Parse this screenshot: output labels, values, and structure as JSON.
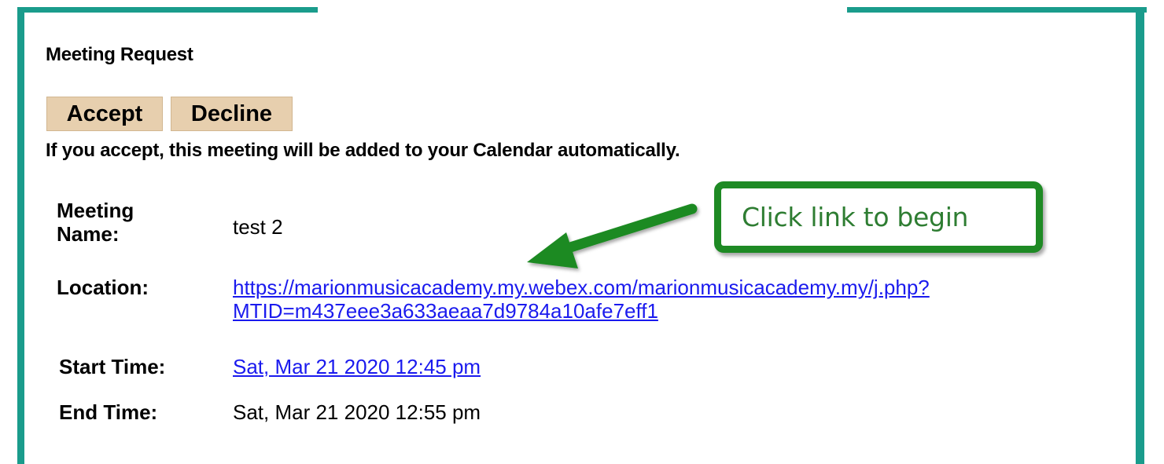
{
  "heading": "Meeting Request",
  "buttons": {
    "accept": "Accept",
    "decline": "Decline"
  },
  "note": "If you accept, this meeting will be added to your Calendar automatically.",
  "details": {
    "meeting_name_label_line1": "Meeting",
    "meeting_name_label_line2": "Name:",
    "meeting_name_value": "test 2",
    "location_label": "Location:",
    "location_line1": "https://marionmusicacademy.my.webex.com/marionmusicacademy.my/j.php?",
    "location_line2": "MTID=m437eee3a633aeaa7d9784a10afe7eff1",
    "start_time_label": "Start Time:",
    "start_time_value": "Sat, Mar 21 2020 12:45 pm",
    "end_time_label": "End Time:",
    "end_time_value": "Sat, Mar 21 2020 12:55 pm"
  },
  "callout": {
    "text": "Click link to begin",
    "color": "#2e7d32",
    "border_color": "#1e8a24"
  },
  "colors": {
    "frame": "#1a9c8c",
    "button_bg": "#e7cfae",
    "link": "#1a1aee"
  }
}
